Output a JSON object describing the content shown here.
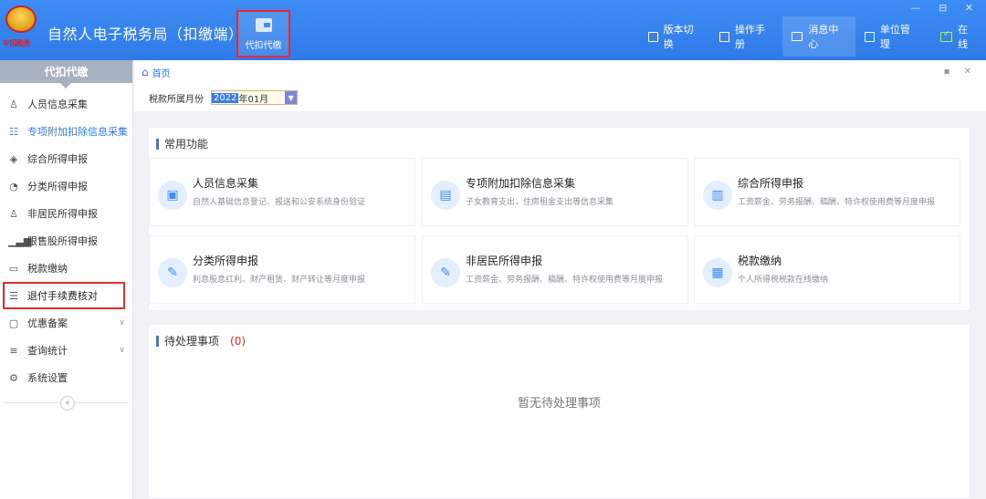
{
  "header": {
    "app_title": "自然人电子税务局（扣缴端）",
    "emblem_text": "中国税务",
    "top_tile_label": "代扣代缴",
    "nav": [
      {
        "label": "版本切换",
        "icon": "document-icon"
      },
      {
        "label": "操作手册",
        "icon": "manual-icon"
      },
      {
        "label": "消息中心",
        "icon": "mail-icon"
      },
      {
        "label": "单位管理",
        "icon": "building-icon"
      }
    ],
    "online_label": "在线",
    "window_controls": "— ⊟ ✕"
  },
  "sidebar": {
    "heading": "代扣代缴",
    "items": [
      {
        "label": "人员信息采集",
        "icon": "person-icon"
      },
      {
        "label": "专项附加扣除信息采集",
        "icon": "list-icon"
      },
      {
        "label": "综合所得申报",
        "icon": "layers-icon"
      },
      {
        "label": "分类所得申报",
        "icon": "pie-icon"
      },
      {
        "label": "非居民所得申报",
        "icon": "person-outline-icon"
      },
      {
        "label": "限售股所得申报",
        "icon": "bar-chart-icon"
      },
      {
        "label": "税款缴纳",
        "icon": "folder-icon"
      },
      {
        "label": "退付手续费核对",
        "icon": "checklist-icon"
      },
      {
        "label": "优惠备案",
        "icon": "copy-icon"
      },
      {
        "label": "查询统计",
        "icon": "search-list-icon"
      },
      {
        "label": "系统设置",
        "icon": "gear-icon"
      }
    ],
    "collapse_symbol": "«"
  },
  "breadcrumb": {
    "home_label": "首页",
    "tools": "▪ ✕"
  },
  "filter": {
    "label": "税款所属月份",
    "year": "2022",
    "month": "年01月",
    "dropdown_symbol": "▼"
  },
  "common_functions": {
    "title": "常用功能",
    "cards": [
      {
        "title": "人员信息采集",
        "desc": "自然人基础信息登记、报送和公安系统身份验证",
        "icon": "id-card-icon"
      },
      {
        "title": "专项附加扣除信息采集",
        "desc": "子女教育支出，住房租金支出等信息采集",
        "icon": "form-icon"
      },
      {
        "title": "综合所得申报",
        "desc": "工资薪金、劳务报酬、稿酬、特许权使用费等月度申报",
        "icon": "report-icon"
      },
      {
        "title": "分类所得申报",
        "desc": "利息股息红利、财产租赁、财产转让等月度申报",
        "icon": "edit-icon"
      },
      {
        "title": "非居民所得申报",
        "desc": "工资薪金、劳务报酬、稿酬、特许权使用费等月度申报",
        "icon": "edit-icon"
      },
      {
        "title": "税款缴纳",
        "desc": "个人所得税税款在线缴纳",
        "icon": "payment-icon"
      }
    ]
  },
  "pending": {
    "title": "待处理事项",
    "count": "(0)",
    "empty_text": "暂无待处理事项"
  }
}
